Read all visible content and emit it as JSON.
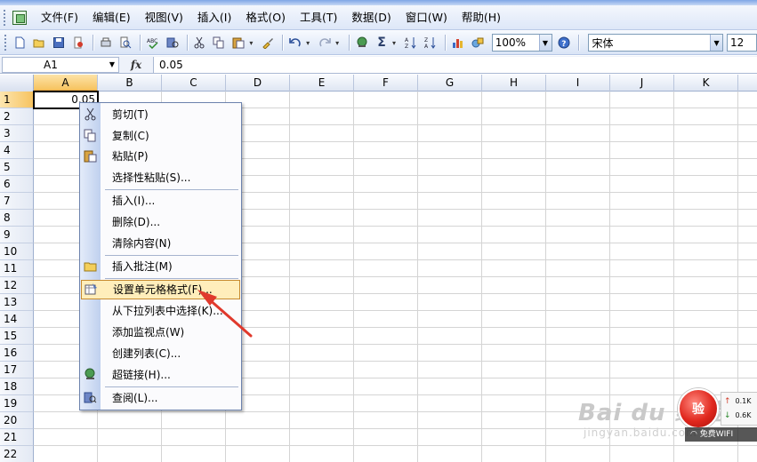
{
  "menubar": {
    "items": [
      "文件(F)",
      "编辑(E)",
      "视图(V)",
      "插入(I)",
      "格式(O)",
      "工具(T)",
      "数据(D)",
      "窗口(W)",
      "帮助(H)"
    ]
  },
  "toolbar": {
    "zoom": "100%",
    "font_name": "宋体",
    "font_size": "12",
    "sigma": "Σ"
  },
  "formula_bar": {
    "name_box": "A1",
    "fx_label": "fx",
    "value": "0.05"
  },
  "grid": {
    "columns": [
      "A",
      "B",
      "C",
      "D",
      "E",
      "F",
      "G",
      "H",
      "I",
      "J",
      "K"
    ],
    "rows": [
      "1",
      "2",
      "3",
      "4",
      "5",
      "6",
      "7",
      "8",
      "9",
      "10",
      "11",
      "12",
      "13",
      "14",
      "15",
      "16",
      "17",
      "18",
      "19",
      "20",
      "21",
      "22"
    ],
    "active_cell_value": "0.05"
  },
  "context_menu": {
    "items": [
      {
        "label": "剪切(T)",
        "icon": "scissors-icon"
      },
      {
        "label": "复制(C)",
        "icon": "copy-icon"
      },
      {
        "label": "粘贴(P)",
        "icon": "paste-icon"
      },
      {
        "label": "选择性粘贴(S)...",
        "icon": ""
      },
      {
        "label": "插入(I)...",
        "icon": ""
      },
      {
        "label": "删除(D)...",
        "icon": ""
      },
      {
        "label": "清除内容(N)",
        "icon": ""
      },
      {
        "label": "插入批注(M)",
        "icon": "comment-folder-icon"
      },
      {
        "label": "设置单元格格式(F)...",
        "icon": "format-cells-icon"
      },
      {
        "label": "从下拉列表中选择(K)...",
        "icon": ""
      },
      {
        "label": "添加监视点(W)",
        "icon": ""
      },
      {
        "label": "创建列表(C)...",
        "icon": ""
      },
      {
        "label": "超链接(H)...",
        "icon": "hyperlink-globe-icon"
      },
      {
        "label": "查阅(L)...",
        "icon": "research-icon"
      }
    ],
    "highlight_color": "#ffeebb"
  },
  "overlay": {
    "watermark": "Bai du 经验",
    "watermark_sub": "jingyan.baidu.com",
    "badge": "验",
    "upload": "0.1K",
    "download": "0.6K",
    "wifi": "免费WIFI"
  },
  "colors": {
    "menu_bg": "#dde7f8",
    "selected_header": "#f6c360",
    "arrow": "#e0392c"
  }
}
